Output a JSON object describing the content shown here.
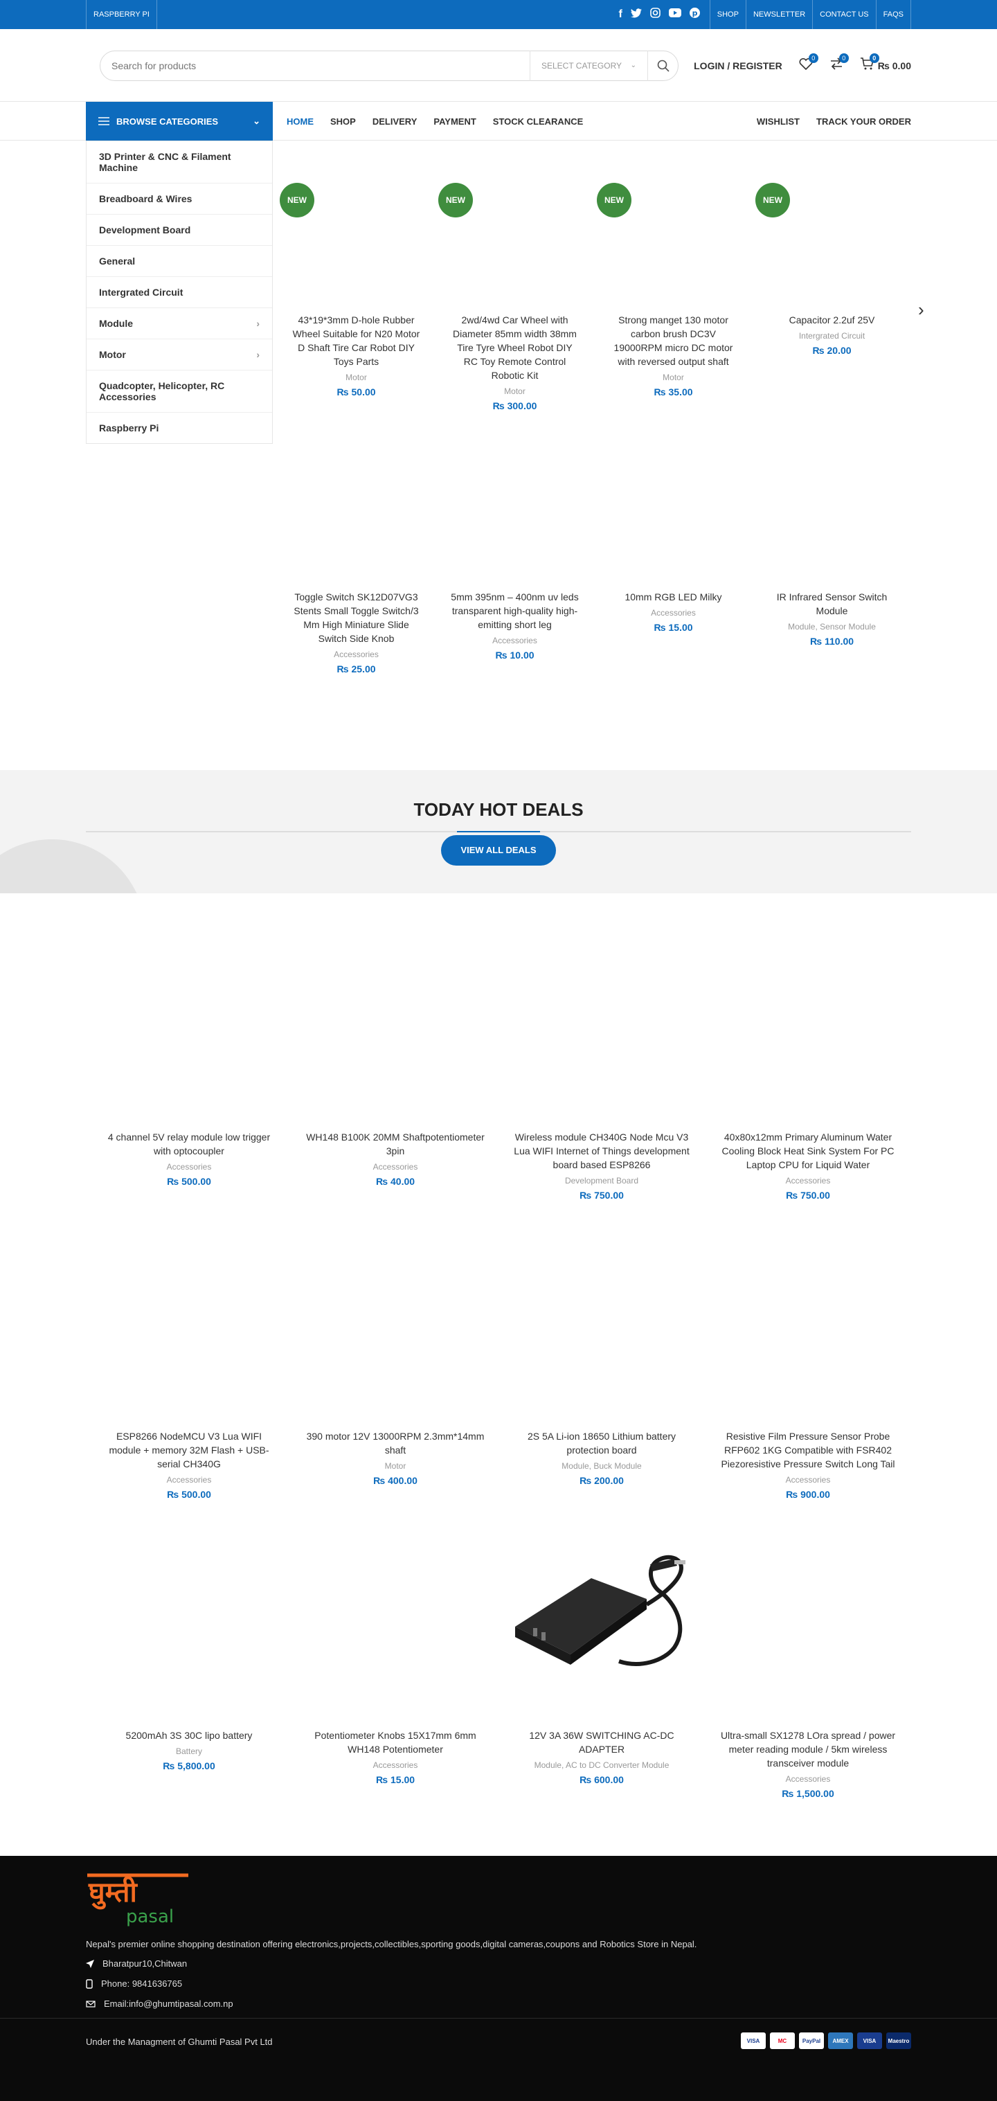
{
  "topbar": {
    "left_label": "RASPBERRY PI",
    "social": [
      "facebook-icon",
      "twitter-icon",
      "instagram-icon",
      "youtube-icon",
      "pinterest-icon"
    ],
    "links": [
      "SHOP",
      "NEWSLETTER",
      "CONTACT US",
      "FAQS"
    ]
  },
  "header": {
    "search_placeholder": "Search for products",
    "category_select": "SELECT CATEGORY",
    "login": "LOGIN / REGISTER",
    "wishlist_count": "0",
    "compare_count": "0",
    "cart_count": "0",
    "cart_total": "₨ 0.00"
  },
  "nav": {
    "browse_label": "BROWSE CATEGORIES",
    "items": [
      "HOME",
      "SHOP",
      "DELIVERY",
      "PAYMENT",
      "STOCK CLEARANCE"
    ],
    "right": [
      "WISHLIST",
      "TRACK YOUR ORDER"
    ]
  },
  "categories": [
    {
      "label": "3D Printer & CNC & Filament Machine"
    },
    {
      "label": "Breadboard & Wires"
    },
    {
      "label": "Development Board"
    },
    {
      "label": "General"
    },
    {
      "label": "Intergrated Circuit"
    },
    {
      "label": "Module",
      "arrow": "›"
    },
    {
      "label": "Motor",
      "arrow": "›"
    },
    {
      "label": "Quadcopter, Helicopter, RC Accessories"
    },
    {
      "label": "Raspberry Pi"
    }
  ],
  "new_badge": "NEW",
  "products": [
    {
      "name": "43*19*3mm D-hole Rubber Wheel Suitable for N20 Motor D Shaft Tire Car Robot DIY Toys Parts",
      "cat": "Motor",
      "price": "₨ 50.00"
    },
    {
      "name": "2wd/4wd Car Wheel with Diameter 85mm width 38mm Tire Tyre Wheel Robot DIY RC Toy Remote Control Robotic Kit",
      "cat": "Motor",
      "price": "₨ 300.00"
    },
    {
      "name": "Strong manget 130 motor carbon brush DC3V 19000RPM micro DC motor with reversed output shaft",
      "cat": "Motor",
      "price": "₨ 35.00"
    },
    {
      "name": "Capacitor 2.2uf 25V",
      "cat": "Intergrated Circuit",
      "price": "₨ 20.00"
    },
    {
      "name": "Toggle Switch SK12D07VG3 Stents Small Toggle Switch/3 Mm High Miniature Slide Switch Side Knob",
      "cat": "Accessories",
      "price": "₨ 25.00"
    },
    {
      "name": "5mm 395nm – 400nm uv leds transparent high-quality high-emitting short leg",
      "cat": "Accessories",
      "price": "₨ 10.00"
    },
    {
      "name": "10mm RGB LED Milky",
      "cat": "Accessories",
      "price": "₨ 15.00"
    },
    {
      "name": "IR Infrared Sensor Switch Module",
      "cat": "Module, Sensor Module",
      "price": "₨ 110.00"
    }
  ],
  "hot_deals": {
    "title": "TODAY HOT DEALS",
    "button": "VIEW ALL DEALS"
  },
  "deals": [
    {
      "name": "4 channel 5V relay module low trigger with optocoupler",
      "cat": "Accessories",
      "price": "₨ 500.00"
    },
    {
      "name": "WH148 B100K 20MM Shaftpotentiometer 3pin",
      "cat": "Accessories",
      "price": "₨ 40.00"
    },
    {
      "name": "Wireless module CH340G Node Mcu V3 Lua WIFI Internet of Things development board based ESP8266",
      "cat": "Development Board",
      "price": "₨ 750.00"
    },
    {
      "name": "40x80x12mm Primary Aluminum Water Cooling Block Heat Sink System For PC Laptop CPU for Liquid Water",
      "cat": "Accessories",
      "price": "₨ 750.00"
    },
    {
      "name": "ESP8266 NodeMCU V3 Lua WIFI module + memory 32M Flash + USB-serial CH340G",
      "cat": "Accessories",
      "price": "₨ 500.00"
    },
    {
      "name": "390 motor 12V 13000RPM 2.3mm*14mm shaft",
      "cat": "Motor",
      "price": "₨ 400.00"
    },
    {
      "name": "2S 5A Li-ion 18650 Lithium battery protection board",
      "cat": "Module, Buck Module",
      "price": "₨ 200.00"
    },
    {
      "name": "Resistive Film Pressure Sensor Probe RFP602 1KG Compatible with FSR402 Piezoresistive Pressure Switch Long Tail",
      "cat": "Accessories",
      "price": "₨ 900.00"
    },
    {
      "name": "5200mAh 3S 30C lipo battery",
      "cat": "Battery",
      "price": "₨ 5,800.00"
    },
    {
      "name": "Potentiometer Knobs 15X17mm 6mm WH148 Potentiometer",
      "cat": "Accessories",
      "price": "₨ 15.00"
    },
    {
      "name": "12V 3A 36W SWITCHING AC-DC ADAPTER",
      "cat": "Module, AC to DC Converter Module",
      "price": "₨ 600.00",
      "image": "adapter"
    },
    {
      "name": "Ultra-small SX1278 LOra spread / power meter reading module / 5km wireless transceiver module",
      "cat": "Accessories",
      "price": "₨ 1,500.00"
    }
  ],
  "footer": {
    "logo_text": "घुम्ती",
    "logo_sub": "pasal",
    "about": "Nepal's premier online shopping destination offering electronics,projects,collectibles,sporting goods,digital cameras,coupons and Robotics Store in Nepal.",
    "address": "Bharatpur10,Chitwan",
    "phone": "Phone: 9841636765",
    "email": "Email:info@ghumtipasal.com.np",
    "copyright": "Under the Managment of Ghumti Pasal Pvt Ltd",
    "payments": [
      "VISA",
      "MC",
      "PayPal",
      "AMEX",
      "VISA",
      "Maestro"
    ]
  },
  "colors": {
    "primary": "#0d6bbd",
    "new_badge": "#3f8d3e",
    "footer_bg": "#0b0b0b"
  }
}
